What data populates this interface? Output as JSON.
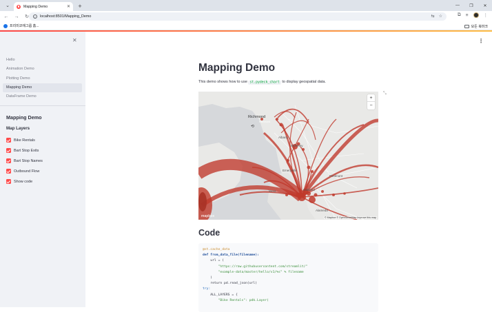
{
  "browser": {
    "tab_title": "Mapping Demo",
    "url": "localhost:8501/Mapping_Demo",
    "bookmark_left": "프리미코에그룹 홈...",
    "bookmark_right": "모든 북마크"
  },
  "sidebar": {
    "nav_items": [
      {
        "label": "Hello",
        "active": false
      },
      {
        "label": "Animation Demo",
        "active": false
      },
      {
        "label": "Plotting Demo",
        "active": false
      },
      {
        "label": "Mapping Demo",
        "active": true
      },
      {
        "label": "DataFrame Demo",
        "active": false
      }
    ],
    "title": "Mapping Demo",
    "layers_title": "Map Layers",
    "checkboxes": [
      {
        "label": "Bike Rentals",
        "checked": true
      },
      {
        "label": "Bart Stop Exits",
        "checked": true
      },
      {
        "label": "Bart Stop Names",
        "checked": true
      },
      {
        "label": "Outbound Flow",
        "checked": true
      },
      {
        "label": "Show code",
        "checked": true
      }
    ]
  },
  "main": {
    "title": "Mapping Demo",
    "intro_before": "This demo shows how to use",
    "intro_code": "st.pydeck_chart",
    "intro_after": "to display geospatial data.",
    "map": {
      "labels": {
        "richmond": "Richmond",
        "albany": "Albany",
        "berkeley": "Berkeley",
        "emeryville": "Emeryville",
        "oakland": "Oakland",
        "piedmont": "Piedmont",
        "alameda": "Alameda",
        "west": "West"
      },
      "attribution": "© Mapbox © OpenStreetMap Improve this map",
      "logo": "mapbox"
    },
    "code_heading": "Code",
    "code_lines": [
      "@st.cache_data",
      "def from_data_file(filename):",
      "    url = (",
      "        \"https://raw.githubusercontent.com/streamlit/\"",
      "        \"example-data/master/hello/v1/%s\" % filename",
      "    )",
      "    return pd.read_json(url)",
      "",
      "try:",
      "    ALL_LAYERS = {",
      "        \"Bike Rentals\": pdk.Layer("
    ]
  },
  "colors": {
    "accent": "#ff4b4b",
    "arc": "#c0392b",
    "sidebar_bg": "#f0f2f6"
  }
}
